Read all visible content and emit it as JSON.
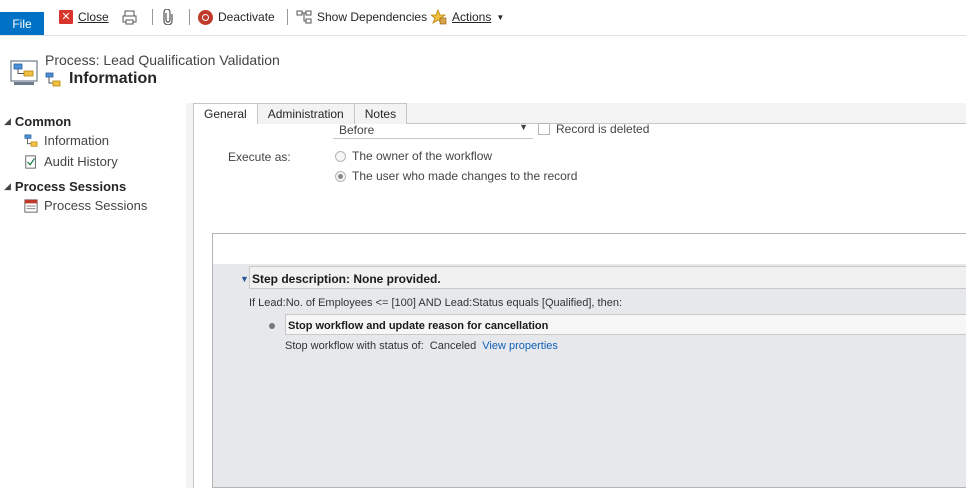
{
  "ribbon": {
    "file_label": "File",
    "close_label": "Close",
    "deactivate_label": "Deactivate",
    "show_dependencies_label": "Show Dependencies",
    "actions_label": "Actions"
  },
  "header": {
    "subtitle": "Process: Lead Qualification Validation",
    "title": "Information"
  },
  "nav": {
    "common_label": "Common",
    "common_items": [
      {
        "label": "Information",
        "icon": "workflow-icon"
      },
      {
        "label": "Audit History",
        "icon": "audit-history-icon"
      }
    ],
    "sessions_label": "Process Sessions",
    "sessions_items": [
      {
        "label": "Process Sessions",
        "icon": "process-sessions-icon"
      }
    ]
  },
  "tabs": [
    {
      "label": "General",
      "active": true
    },
    {
      "label": "Administration",
      "active": false
    },
    {
      "label": "Notes",
      "active": false
    }
  ],
  "form": {
    "timing_value": "Before",
    "record_deleted_label": "Record is deleted",
    "record_deleted_checked": false,
    "execute_as_label": "Execute as:",
    "execute_as_options": [
      {
        "label": "The owner of the workflow",
        "selected": false
      },
      {
        "label": "The user who made changes to the record",
        "selected": true
      }
    ]
  },
  "designer": {
    "step_description": "Step description: None provided.",
    "condition": "If Lead:No. of Employees <= [100] AND Lead:Status equals [Qualified], then:",
    "action_title": "Stop workflow and update reason for cancellation",
    "action_desc_prefix": "Stop workflow with status of:",
    "action_status": "Canceled",
    "action_link": "View properties"
  },
  "colors": {
    "file_button": "#0072c6",
    "link": "#1160b7",
    "designer_bg": "#e6e8ec"
  }
}
